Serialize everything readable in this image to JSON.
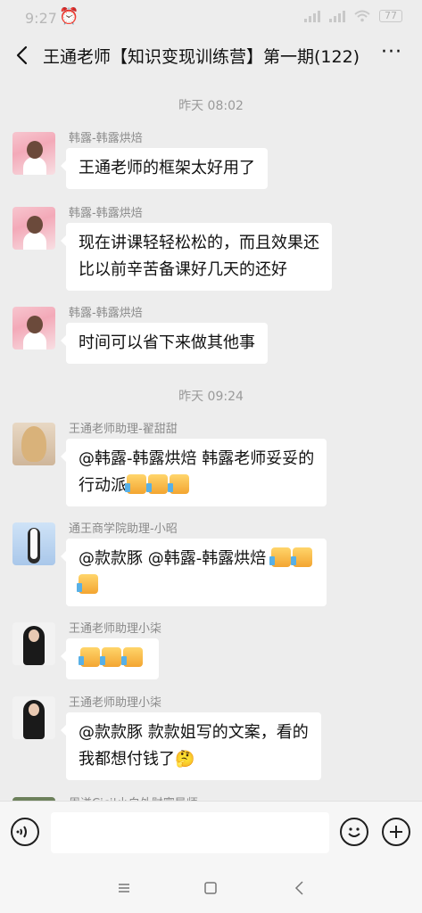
{
  "status_bar": {
    "time": "9:27",
    "battery": "77"
  },
  "header": {
    "title": "王通老师【知识变现训练营】第一期(122)",
    "more": "···"
  },
  "timestamps": [
    "昨天 08:02",
    "昨天 09:24"
  ],
  "messages": [
    {
      "sender": "韩露-韩露烘焙",
      "text": "王通老师的框架太好用了",
      "avatar": "pink"
    },
    {
      "sender": "韩露-韩露烘焙",
      "lines": [
        "现在讲课轻轻松松的，而且效果还",
        "比以前辛苦备课好几天的还好"
      ],
      "avatar": "pink"
    },
    {
      "sender": "韩露-韩露烘焙",
      "text": "时间可以省下来做其他事",
      "avatar": "pink"
    },
    {
      "sender": "王通老师助理-翟甜甜",
      "lines": [
        "@韩露-韩露烘焙  韩露老师妥妥的",
        "行动派"
      ],
      "thumbs": 3,
      "avatar": "blond"
    },
    {
      "sender": "通王商学院助理-小昭",
      "lines": [
        "@款款豚  @韩露-韩露烘焙 ",
        ""
      ],
      "thumbs": 3,
      "avatar": "white"
    },
    {
      "sender": "王通老师助理小柒",
      "text": "",
      "thumbs": 3,
      "avatar": "black"
    },
    {
      "sender": "王通老师助理小柒",
      "lines": [
        "@款款豚  款款姐写的文案，看的",
        "我都想付钱了🤔"
      ],
      "avatar": "black"
    },
    {
      "sender": "周谦Cici|小白外财富导师",
      "avatar": "green"
    }
  ],
  "icons": {
    "voice": "voice-icon",
    "emoji": "emoji-icon",
    "plus": "plus-icon",
    "back": "back-arrow-icon",
    "nav_menu": "menu-icon",
    "nav_home": "home-icon",
    "nav_back": "nav-back-icon"
  },
  "colors": {
    "background": "#ededed",
    "bubble": "#ffffff",
    "timestamp": "#9a9a9a",
    "sender": "#8a8a8a"
  }
}
